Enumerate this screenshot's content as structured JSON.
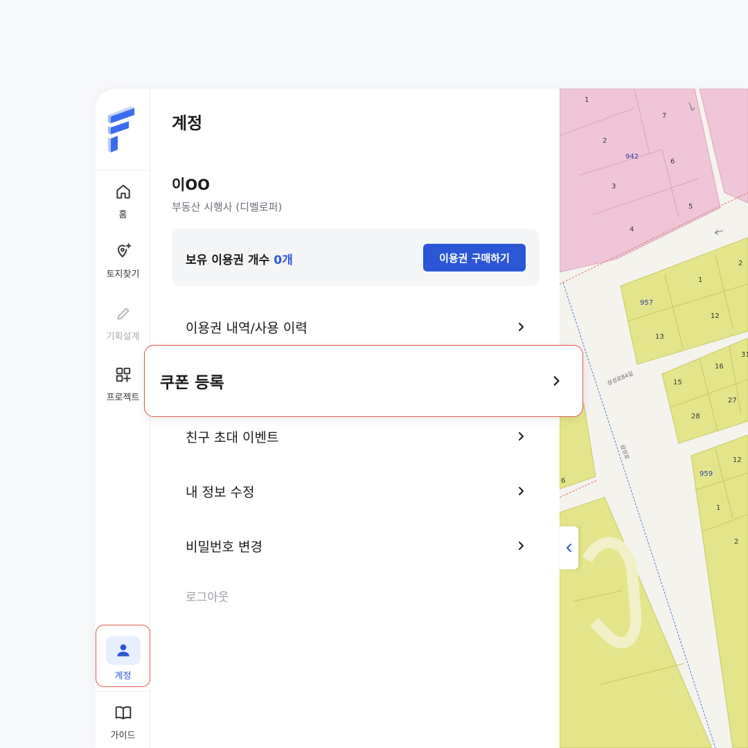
{
  "sidebar": {
    "items": [
      {
        "label": "홈",
        "icon": "home-icon"
      },
      {
        "label": "토지찾기",
        "icon": "map-pin-plus-icon"
      },
      {
        "label": "기획설계",
        "icon": "pencil-icon",
        "disabled": true
      },
      {
        "label": "프로젝트",
        "icon": "grid-plus-icon"
      },
      {
        "label": "계정",
        "icon": "user-icon",
        "active": true
      },
      {
        "label": "가이드",
        "icon": "book-icon"
      }
    ]
  },
  "account": {
    "title": "계정",
    "user_name": "이OO",
    "user_role": "부동산 시행사 (디벨로퍼)",
    "ticket_label": "보유 이용권 개수",
    "ticket_count": "0개",
    "buy_button": "이용권 구매하기",
    "menu": [
      {
        "label": "이용권 내역/사용 이력"
      },
      {
        "label": "쿠폰 등록",
        "highlighted": true
      },
      {
        "label": "친구 초대 이벤트"
      },
      {
        "label": "내 정보 수정"
      },
      {
        "label": "비밀번호 변경"
      }
    ],
    "logout": "로그아웃"
  },
  "map": {
    "parcel_labels": [
      "1",
      "7",
      "2",
      "942",
      "6",
      "3",
      "5",
      "4",
      "2",
      "1",
      "957",
      "12",
      "13",
      "16",
      "31",
      "15",
      "27",
      "28",
      "6",
      "12",
      "959",
      "1",
      "2"
    ],
    "road_labels": [
      "삼성로84길",
      "삼성로"
    ]
  },
  "colors": {
    "accent": "#2b57d6",
    "highlight_border": "#e05a4f",
    "pink_zone": "#eec6d8",
    "yellow_zone": "#e4e58a"
  }
}
